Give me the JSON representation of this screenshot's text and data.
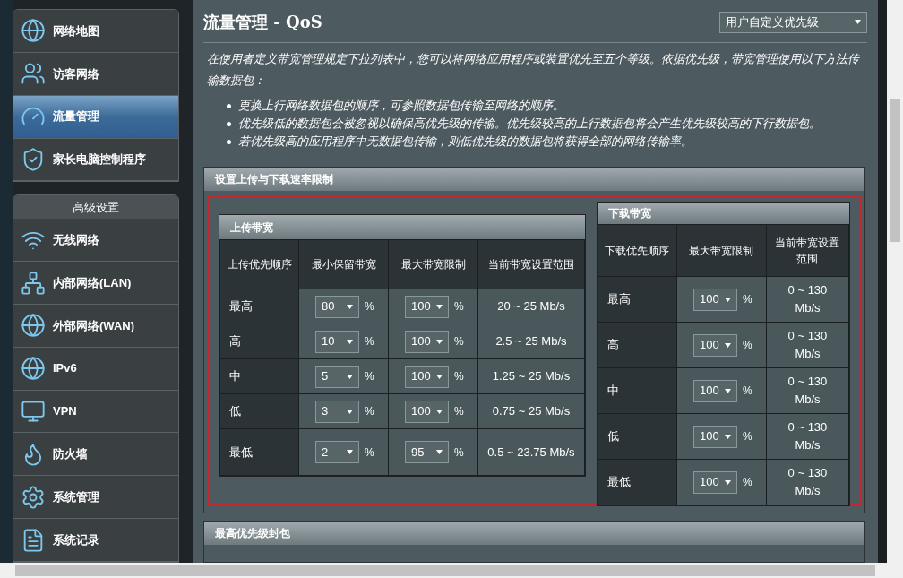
{
  "sidebar": {
    "groups": [
      {
        "items": [
          {
            "label": "网络地图",
            "selected": false
          },
          {
            "label": "访客网络",
            "selected": false
          },
          {
            "label": "流量管理",
            "selected": true
          },
          {
            "label": "家长电脑控制程序",
            "selected": false
          }
        ]
      },
      {
        "title": "高级设置",
        "items": [
          {
            "label": "无线网络",
            "selected": false
          },
          {
            "label": "内部网络(LAN)",
            "selected": false
          },
          {
            "label": "外部网络(WAN)",
            "selected": false
          },
          {
            "label": "IPv6",
            "selected": false
          },
          {
            "label": "VPN",
            "selected": false
          },
          {
            "label": "防火墙",
            "selected": false
          },
          {
            "label": "系统管理",
            "selected": false
          },
          {
            "label": "系统记录",
            "selected": false
          }
        ]
      }
    ]
  },
  "page": {
    "title": "流量管理 - QoS",
    "mode_select": "用户自定义优先级",
    "intro": "在使用者定义带宽管理规定下拉列表中，您可以将网络应用程序或装置优先至五个等级。依据优先级，带宽管理使用以下方法传输数据包：",
    "bullets": [
      "更换上行网络数据包的顺序，可参照数据包传输至网络的顺序。",
      "优先级低的数据包会被忽视以确保高优先级的传输。优先级较高的上行数据包将会产生优先级较高的下行数据包。",
      "若优先级高的应用程序中无数据包传输，则低优先级的数据包将获得全部的网络传输率。"
    ]
  },
  "rate_section": {
    "title": "设置上传与下载速率限制",
    "upload": {
      "title": "上传带宽",
      "columns": [
        "上传优先顺序",
        "最小保留带宽",
        "最大带宽限制",
        "当前带宽设置范围"
      ],
      "rows": [
        {
          "priority": "最高",
          "min": "80",
          "min_unit": "%",
          "max": "100",
          "max_unit": "%",
          "range": "20 ~ 25 Mb/s"
        },
        {
          "priority": "高",
          "min": "10",
          "min_unit": "%",
          "max": "100",
          "max_unit": "%",
          "range": "2.5 ~ 25 Mb/s"
        },
        {
          "priority": "中",
          "min": "5",
          "min_unit": "%",
          "max": "100",
          "max_unit": "%",
          "range": "1.25 ~ 25 Mb/s"
        },
        {
          "priority": "低",
          "min": "3",
          "min_unit": "%",
          "max": "100",
          "max_unit": "%",
          "range": "0.75 ~ 25 Mb/s"
        },
        {
          "priority": "最低",
          "min": "2",
          "min_unit": "%",
          "max": "95",
          "max_unit": "%",
          "range": "0.5 ~ 23.75 Mb/s"
        }
      ]
    },
    "download": {
      "title": "下载带宽",
      "columns": [
        "下载优先顺序",
        "最大带宽限制",
        "当前带宽设置范围"
      ],
      "rows": [
        {
          "priority": "最高",
          "max": "100",
          "max_unit": "%",
          "range": "0 ~ 130 Mb/s"
        },
        {
          "priority": "高",
          "max": "100",
          "max_unit": "%",
          "range": "0 ~ 130 Mb/s"
        },
        {
          "priority": "中",
          "max": "100",
          "max_unit": "%",
          "range": "0 ~ 130 Mb/s"
        },
        {
          "priority": "低",
          "max": "100",
          "max_unit": "%",
          "range": "0 ~ 130 Mb/s"
        },
        {
          "priority": "最低",
          "max": "100",
          "max_unit": "%",
          "range": "0 ~ 130 Mb/s"
        }
      ]
    }
  },
  "packet_section": {
    "title": "最高优先级封包"
  }
}
